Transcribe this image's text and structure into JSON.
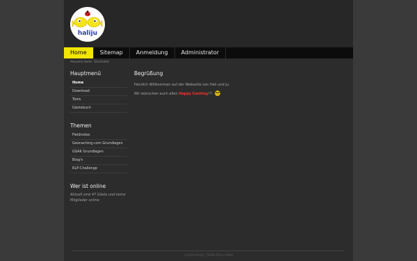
{
  "logo": {
    "text": "haliju"
  },
  "nav": {
    "items": [
      {
        "label": "Home",
        "active": true
      },
      {
        "label": "Sitemap",
        "active": false
      },
      {
        "label": "Anmeldung",
        "active": false
      },
      {
        "label": "Administrator",
        "active": false
      }
    ]
  },
  "breadcrumb": {
    "prefix": "Aktuelle Seite:",
    "current": "Startseite"
  },
  "sidebar": {
    "main_menu": {
      "title": "Hauptmenü",
      "items": [
        "Home",
        "Download",
        "Tools",
        "Gästebuch"
      ]
    },
    "themes": {
      "title": "Themen",
      "items": [
        "Fieldnotes",
        "Geocaching.com Grundlagen",
        "GSAK Grundlagen",
        "Blog'n",
        "RLP-Challenge"
      ]
    },
    "online": {
      "title": "Wer ist online",
      "text": "Aktuell sind 47 Gäste und keine Mitglieder online"
    }
  },
  "content": {
    "title": "Begrüßung",
    "welcome": "Herzlich Willkommen auf der Webseite von Hali und Ju.",
    "wish_prefix": "Wir wünschen euch allen",
    "wish_highlight": "Happy Caching",
    "wish_suffix": "!!!",
    "smiley_icon": "cool-smiley-icon"
  },
  "footer": {
    "text": "©2019 HALIJU | TEMPLATE by MWS"
  },
  "colors": {
    "accent": "#f2e500",
    "highlight": "#ff3030",
    "background": "#2c2c2c",
    "nav": "#0c0c0c"
  }
}
